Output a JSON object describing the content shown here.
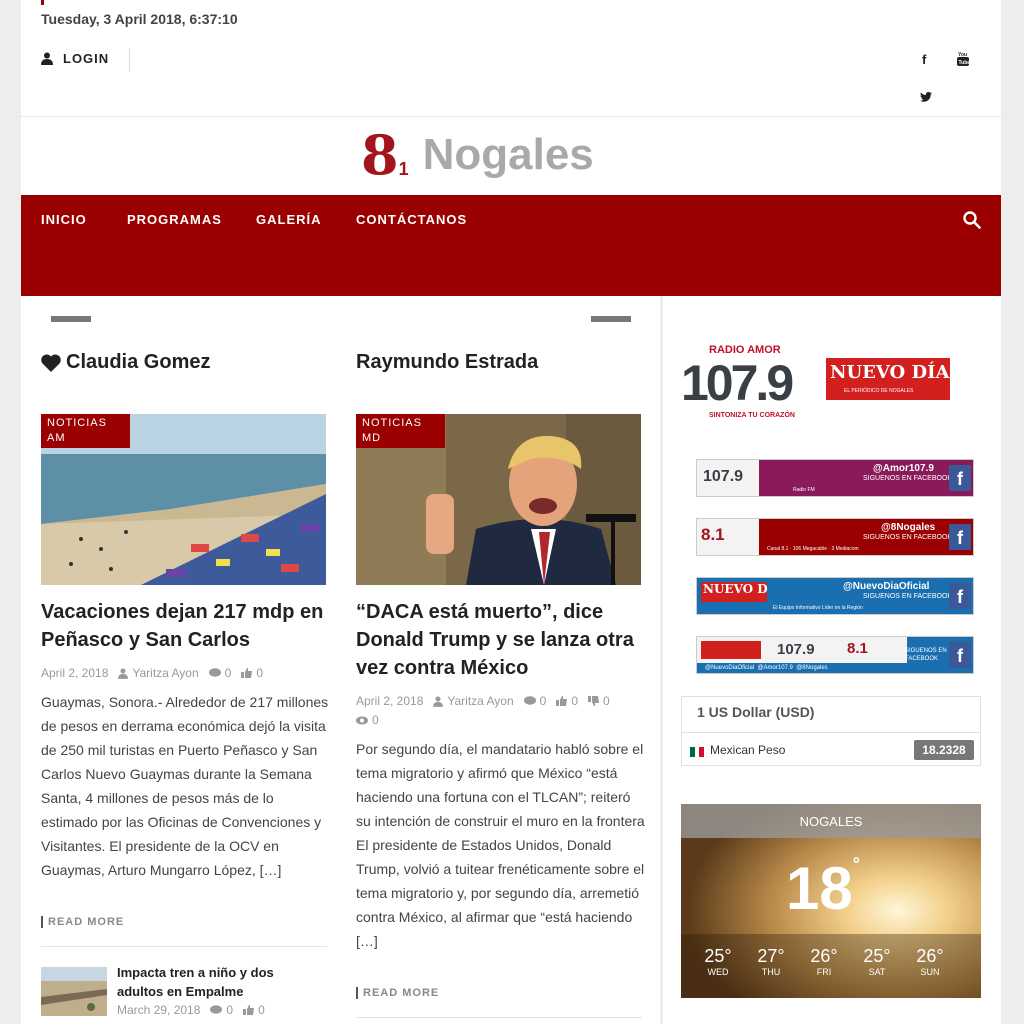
{
  "header": {
    "date": "Tuesday, 3 April 2018, 6:37:10",
    "login_label": "LOGIN"
  },
  "logo": {
    "eight": "8",
    "one": "1",
    "name": "Nogales"
  },
  "nav": {
    "items": [
      "INICIO",
      "PROGRAMAS",
      "GALERÍA",
      "CONTÁCTANOS"
    ]
  },
  "columns": [
    {
      "author": "Claudia Gomez",
      "category": "NOTICIAS AM",
      "headline": "Vacaciones dejan 217 mdp en Peñasco y San Carlos",
      "date": "April 2, 2018",
      "byline": "Yaritza Ayon",
      "comments": "0",
      "likes": "0",
      "excerpt": "Guaymas, Sonora.- Alrededor de 217 millones de pesos en derrama económica dejó la visita de 250 mil turistas en Puerto Peñasco y San Carlos Nuevo Guaymas durante la Semana Santa, 4 millones de pesos más de lo estimado por las Oficinas de Convenciones y Visitantes. El presidente de la OCV en Guaymas, Arturo Mungarro López, […]",
      "read_more": "READ MORE",
      "related": {
        "title": "Impacta tren a niño y dos adultos en Empalme",
        "date": "March 29, 2018",
        "comments": "0",
        "likes": "0"
      }
    },
    {
      "author": "Raymundo Estrada",
      "category": "NOTICIAS MD",
      "headline": "“DACA está muerto”, dice Donald Trump y se lanza otra vez contra México",
      "date": "April 2, 2018",
      "byline": "Yaritza Ayon",
      "comments": "0",
      "likes": "0",
      "dislikes": "0",
      "views": "0",
      "excerpt": "Por segundo día, el mandatario habló sobre el tema migratorio y afirmó que México “está haciendo una fortuna con el TLCAN”; reiteró su intención de construir el muro en la frontera El presidente de Estados Unidos, Donald Trump, volvió a tuitear frenéticamente sobre el tema migratorio y, por segundo día, arremetió contra México, al afirmar que “está haciendo […]",
      "read_more": "READ MORE"
    }
  ],
  "sidebar": {
    "radio": {
      "top": "RADIO AMOR",
      "freq": "107.9",
      "tagline": "SINTONIZA TU CORAZÓN"
    },
    "paper": {
      "name": "NUEVO DÍA",
      "tagline": "EL PERIÓDICO DE NOGALES"
    },
    "banners": [
      {
        "handle": "@Amor107.9",
        "cta": "SIGUENOS EN FACEBOOK",
        "brand": "107.9",
        "sub": "Radio FM",
        "color": "#8a1a5a"
      },
      {
        "handle": "@8Nogales",
        "cta": "SIGUENOS EN FACEBOOK",
        "brand": "8.1",
        "sub": "Canal 8.1 · 106 Megacable · 3 Mediacom",
        "color": "#9b0000"
      },
      {
        "handle": "@NuevoDiaOficial",
        "cta": "SIGUENOS EN FACEBOOK",
        "brand": "NUEVO DÍA",
        "sub": "El Equipo Informativo Líder en la Región",
        "color": "#1a6fb0"
      },
      {
        "handle": "@NuevoDiaOficial  @Amor107.9  @8Nogales",
        "cta": "SIGUENOS EN FACEBOOK",
        "brand": "",
        "sub": "",
        "color": "#1a6fb0"
      }
    ],
    "currency": {
      "base": "1 US Dollar (USD)",
      "target": "Mexican Peso",
      "rate": "18.2328"
    },
    "weather": {
      "city": "NOGALES",
      "temp": "18",
      "forecast": [
        {
          "day": "WED",
          "temp": "25"
        },
        {
          "day": "THU",
          "temp": "27"
        },
        {
          "day": "FRI",
          "temp": "26"
        },
        {
          "day": "SAT",
          "temp": "25"
        },
        {
          "day": "SUN",
          "temp": "26"
        }
      ]
    }
  },
  "colors": {
    "brand_red": "#9b0000",
    "logo_gray": "#a9a9a9"
  }
}
